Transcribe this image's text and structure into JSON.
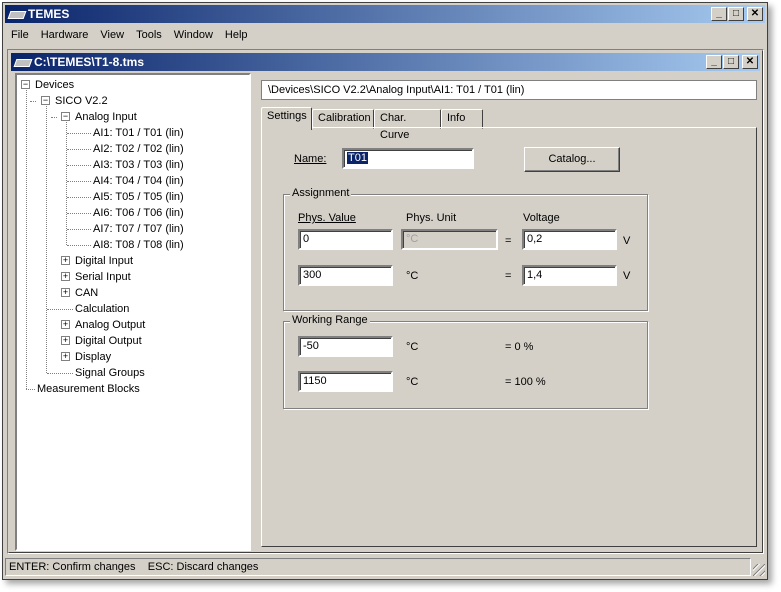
{
  "app": {
    "title": "TEMES",
    "menu": [
      "File",
      "Hardware",
      "View",
      "Tools",
      "Window",
      "Help"
    ]
  },
  "child": {
    "title": "C:\\TEMES\\T1-8.tms"
  },
  "tree": {
    "root": "Devices",
    "device": "SICO V2.2",
    "analog_input": "Analog Input",
    "channels": [
      "AI1: T01 / T01 (lin)",
      "AI2: T02 / T02 (lin)",
      "AI3: T03 / T03 (lin)",
      "AI4: T04 / T04 (lin)",
      "AI5: T05 / T05 (lin)",
      "AI6: T06 / T06 (lin)",
      "AI7: T07 / T07 (lin)",
      "AI8: T08 / T08 (lin)"
    ],
    "others": [
      {
        "label": "Digital Input",
        "expandable": true
      },
      {
        "label": "Serial Input",
        "expandable": true
      },
      {
        "label": "CAN",
        "expandable": true
      },
      {
        "label": "Calculation",
        "expandable": false
      },
      {
        "label": "Analog Output",
        "expandable": true
      },
      {
        "label": "Digital Output",
        "expandable": true
      },
      {
        "label": "Display",
        "expandable": true
      },
      {
        "label": "Signal Groups",
        "expandable": false
      }
    ],
    "measurement_blocks": "Measurement Blocks"
  },
  "path": "\\Devices\\SICO V2.2\\Analog Input\\AI1: T01 / T01 (lin)",
  "tabs": [
    "Settings",
    "Calibration",
    "Char. Curve",
    "Info"
  ],
  "active_tab": "Settings",
  "settings": {
    "name_label": "Name:",
    "name_value": "T01",
    "catalog_button": "Catalog...",
    "assignment": {
      "legend": "Assignment",
      "col_phys_value": "Phys. Value",
      "col_phys_unit": "Phys. Unit",
      "col_voltage": "Voltage",
      "row1": {
        "phys_value": "0",
        "unit": "°C",
        "eq": "=",
        "voltage": "0,2",
        "v": "V"
      },
      "row2": {
        "phys_value": "300",
        "unit": "°C",
        "eq": "=",
        "voltage": "1,4",
        "v": "V"
      }
    },
    "working_range": {
      "legend": "Working Range",
      "row1": {
        "value": "-50",
        "unit": "°C",
        "pct": "= 0 %"
      },
      "row2": {
        "value": "1150",
        "unit": "°C",
        "pct": "= 100 %"
      }
    }
  },
  "status": "ENTER: Confirm changes    ESC: Discard changes"
}
